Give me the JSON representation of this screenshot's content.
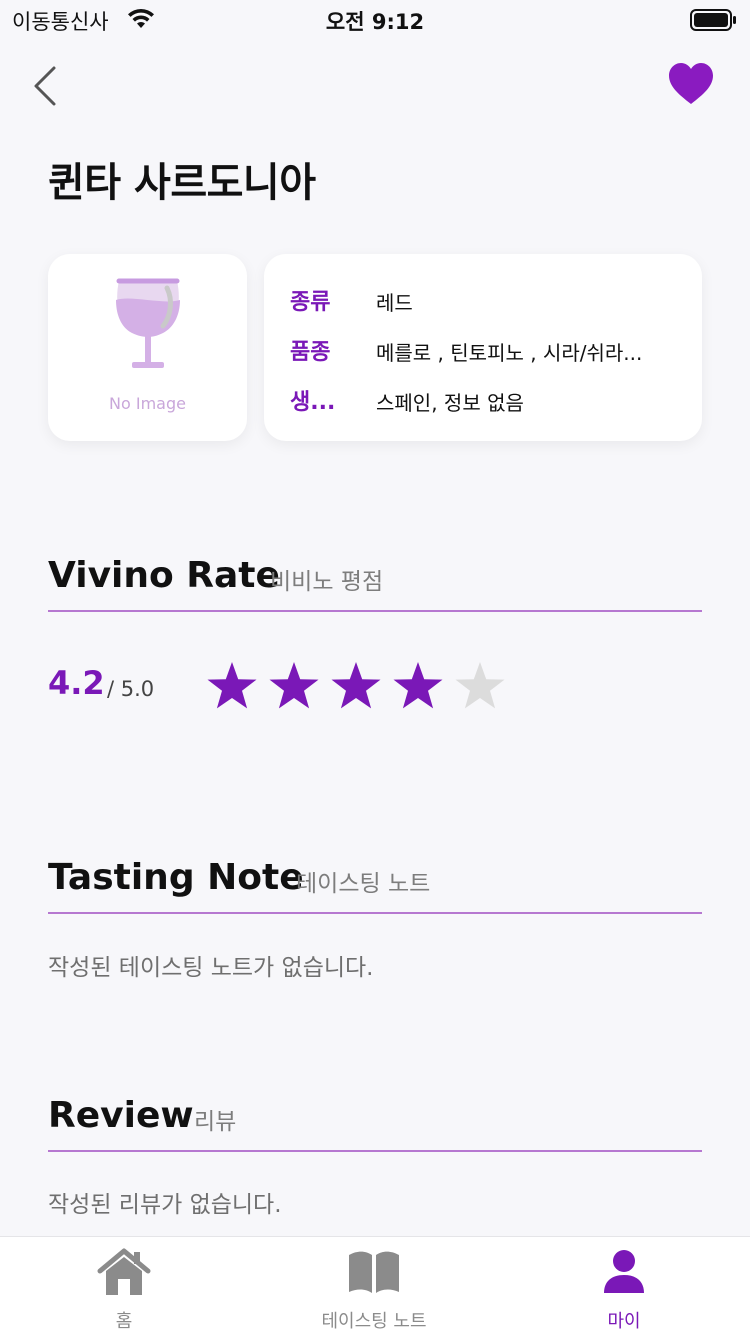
{
  "status_bar": {
    "carrier": "이동통신사",
    "time": "오전 9:12"
  },
  "header": {
    "back_icon": "chevron-left-icon",
    "favorite_icon": "heart-icon",
    "favorite_color": "#8a1bc0"
  },
  "wine": {
    "name": "퀸타 사르도니아",
    "image_placeholder": "No Image",
    "info": [
      {
        "label": "종류",
        "value": "레드"
      },
      {
        "label": "품종",
        "value": "메를로 , 틴토피노 , 시라/쉬라..."
      },
      {
        "label": "생...",
        "value": "스페인, 정보 없음"
      }
    ]
  },
  "vivino": {
    "title": "Vivino Rate",
    "subtitle": "비비노 평점",
    "rating": "4.2",
    "rating_max": "/ 5.0",
    "stars_filled": 4,
    "stars_total": 5
  },
  "tasting_note": {
    "title": "Tasting Note",
    "subtitle": "테이스팅 노트",
    "empty_text": "작성된 테이스팅 노트가 없습니다."
  },
  "review": {
    "title": "Review",
    "subtitle": "리뷰",
    "empty_text": "작성된 리뷰가 없습니다."
  },
  "tab_bar": {
    "tabs": [
      {
        "label": "홈",
        "icon": "home-icon",
        "active": false
      },
      {
        "label": "테이스팅 노트",
        "icon": "book-icon",
        "active": false
      },
      {
        "label": "마이",
        "icon": "person-icon",
        "active": true
      }
    ]
  },
  "colors": {
    "accent": "#7a18b7",
    "divider": "#b678d0",
    "star_empty": "#dcdcdc",
    "background": "#f7f7fa"
  }
}
